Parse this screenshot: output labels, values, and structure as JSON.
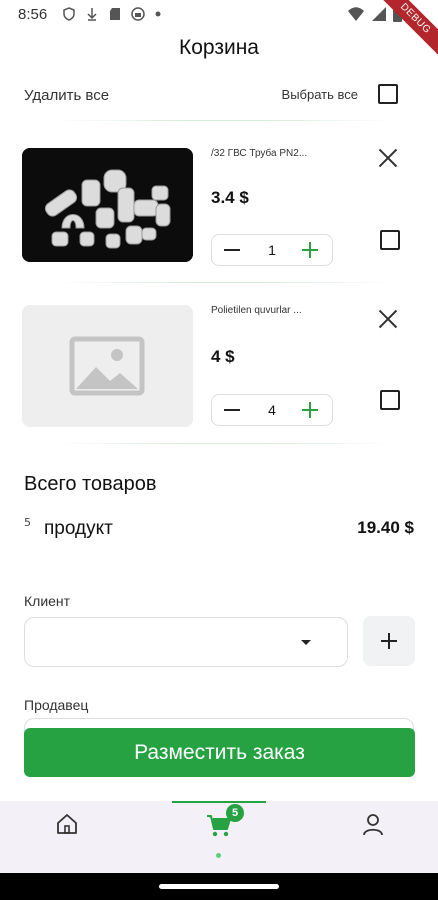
{
  "status_bar": {
    "time": "8:56",
    "banner": "DEBUG"
  },
  "header": {
    "title": "Корзина"
  },
  "actions": {
    "delete_all": "Удалить все",
    "select_all": "Выбрать все"
  },
  "cart_items": [
    {
      "name": "/32 ГВС Труба PN2...",
      "price": "3.4 $",
      "quantity": "1",
      "image": "pipe-fittings-photo"
    },
    {
      "name": "Polietilen quvurlar ...",
      "price": "4 $",
      "quantity": "4",
      "image": "image-placeholder-icon"
    }
  ],
  "summary": {
    "title": "Всего товаров",
    "count": "5",
    "unit": "продукт",
    "total": "19.40 $"
  },
  "form": {
    "client_label": "Клиент",
    "seller_label": "Продавец"
  },
  "order_button": "Разместить заказ",
  "bottom_nav": {
    "cart_badge": "5",
    "items": [
      "home-icon",
      "cart-icon",
      "profile-icon"
    ]
  },
  "colors": {
    "accent": "#27a243",
    "nav_bg": "#f4f0f7",
    "debug": "#b3262b"
  }
}
